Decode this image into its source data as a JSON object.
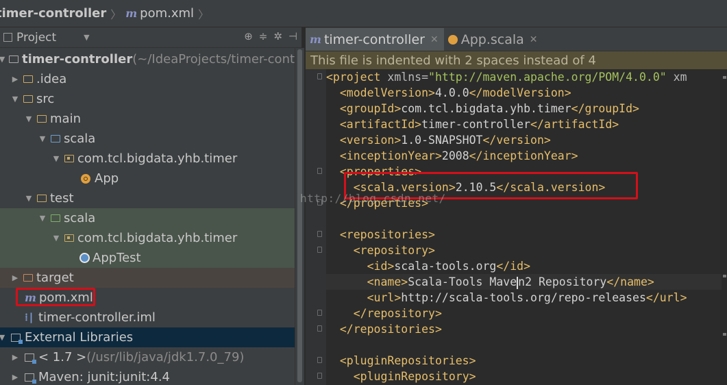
{
  "breadcrumb": {
    "project": "timer-controller",
    "file": "pom.xml"
  },
  "project_panel": {
    "title": "Project",
    "tools": [
      "⊕",
      "≑",
      "✲",
      "⊣"
    ]
  },
  "tree": [
    {
      "label": "timer-controller",
      "suffix": " (~/IdeaProjects/timer-contro",
      "expanded": true
    },
    {
      "label": ".idea"
    },
    {
      "label": "src"
    },
    {
      "label": "main"
    },
    {
      "label": "scala"
    },
    {
      "label": "com.tcl.bigdata.yhb.timer"
    },
    {
      "label": "App"
    },
    {
      "label": "test"
    },
    {
      "label": "scala"
    },
    {
      "label": "com.tcl.bigdata.yhb.timer"
    },
    {
      "label": "AppTest"
    },
    {
      "label": "target"
    },
    {
      "label": "pom.xml"
    },
    {
      "label": "timer-controller.iml"
    },
    {
      "label": "External Libraries"
    },
    {
      "label": "< 1.7 >",
      "suffix": " (/usr/lib/java/jdk1.7.0_79)"
    },
    {
      "label": "Maven: junit:junit:4.4"
    }
  ],
  "tabs": [
    {
      "label": "timer-controller",
      "active": true
    },
    {
      "label": "App.scala",
      "active": false
    }
  ],
  "notice": "This file is indented with 2 spaces instead of 4",
  "code_lines": [
    {
      "indent": "",
      "open": "<project",
      "attr": " xmlns=",
      "str": "\"http://maven.apache.org/POM/4.0.0\"",
      "rest": " xm"
    },
    {
      "indent": "  ",
      "open": "<modelVersion>",
      "text": "4.0.0",
      "close": "</modelVersion>"
    },
    {
      "indent": "  ",
      "open": "<groupId>",
      "text": "com.tcl.bigdata.yhb.timer",
      "close": "</groupId>"
    },
    {
      "indent": "  ",
      "open": "<artifactId>",
      "text": "timer-controller",
      "close": "</artifactId>"
    },
    {
      "indent": "  ",
      "open": "<version>",
      "text": "1.0-SNAPSHOT",
      "close": "</version>"
    },
    {
      "indent": "  ",
      "open": "<inceptionYear>",
      "text": "2008",
      "close": "</inceptionYear>"
    },
    {
      "indent": "  ",
      "open": "<properties>",
      "text": "",
      "close": ""
    },
    {
      "indent": "    ",
      "open": "<scala.version>",
      "text": "2.10.5",
      "close": "</scala.version>"
    },
    {
      "indent": "  ",
      "open": "</properties>",
      "text": "",
      "close": ""
    },
    {
      "indent": "",
      "open": "",
      "text": "",
      "close": ""
    },
    {
      "indent": "  ",
      "open": "<repositories>",
      "text": "",
      "close": ""
    },
    {
      "indent": "    ",
      "open": "<repository>",
      "text": "",
      "close": ""
    },
    {
      "indent": "      ",
      "open": "<id>",
      "text": "scala-tools.org",
      "close": "</id>"
    },
    {
      "indent": "      ",
      "open": "<name>",
      "text_a": "Scala-Tools Mave",
      "text_b": "n2 Repository",
      "close": "</name>"
    },
    {
      "indent": "      ",
      "open": "<url>",
      "text": "http://scala-tools.org/repo-releases",
      "close": "</url>"
    },
    {
      "indent": "    ",
      "open": "</repository>",
      "text": "",
      "close": ""
    },
    {
      "indent": "  ",
      "open": "</repositories>",
      "text": "",
      "close": ""
    },
    {
      "indent": "",
      "open": "",
      "text": "",
      "close": ""
    },
    {
      "indent": "  ",
      "open": "<pluginRepositories>",
      "text": "",
      "close": ""
    },
    {
      "indent": "    ",
      "open": "<pluginRepository>",
      "text": "",
      "close": ""
    }
  ],
  "watermark": "http://blog.csdn.net/",
  "colors": {
    "tag": "#e8bf6a",
    "string": "#a5c25c",
    "highlight_box": "#d2101a",
    "panel": "#3c3f41",
    "editor": "#2b2b2b"
  }
}
